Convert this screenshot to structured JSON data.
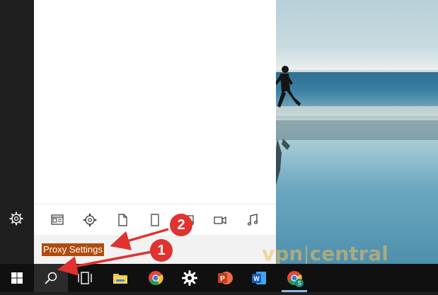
{
  "search": {
    "query": "Proxy Settings"
  },
  "filters": [
    {
      "name": "apps",
      "icon": "app-window-icon"
    },
    {
      "name": "settings",
      "icon": "gear-icon"
    },
    {
      "name": "documents",
      "icon": "document-icon"
    },
    {
      "name": "tablet",
      "icon": "tablet-icon"
    },
    {
      "name": "photos",
      "icon": "image-icon"
    },
    {
      "name": "videos",
      "icon": "video-camera-icon"
    },
    {
      "name": "music",
      "icon": "music-note-icon"
    }
  ],
  "taskbar": [
    "windows-start-icon",
    "search-icon",
    "task-view-icon",
    "file-explorer-icon",
    "chrome-icon",
    "settings-gear-icon",
    "powerpoint-icon",
    "word-icon",
    "chrome-profile-icon"
  ],
  "annotations": {
    "step1": "1",
    "step2": "2",
    "color": "#e0322e"
  },
  "watermark": {
    "part1": "vpn",
    "part2": "central"
  }
}
